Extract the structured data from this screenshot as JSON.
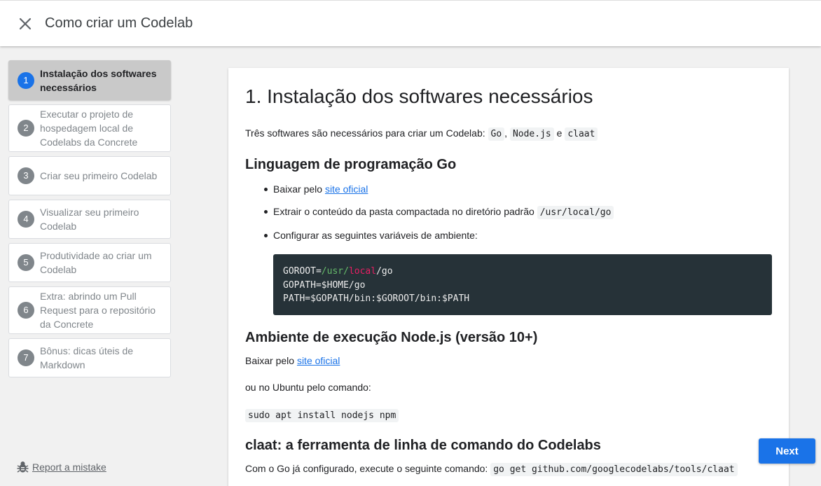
{
  "header": {
    "title": "Como criar um Codelab",
    "close_icon": "close-icon"
  },
  "sidebar": {
    "steps": [
      {
        "number": "1",
        "label": "Instalação dos softwares necessários",
        "active": true
      },
      {
        "number": "2",
        "label": "Executar o projeto de hospedagem local de Codelabs da Concrete"
      },
      {
        "number": "3",
        "label": "Criar seu primeiro Codelab"
      },
      {
        "number": "4",
        "label": "Visualizar seu primeiro Codelab"
      },
      {
        "number": "5",
        "label": "Produtividade ao criar um Codelab"
      },
      {
        "number": "6",
        "label": "Extra: abrindo um Pull Request para o repositório da Concrete"
      },
      {
        "number": "7",
        "label": "Bônus: dicas úteis de Markdown"
      }
    ],
    "report_label": "Report a mistake",
    "report_icon": "bug-icon"
  },
  "content": {
    "title": "1. Instalação dos softwares necessários",
    "intro_text": "Três softwares são necessários para criar um Codelab:",
    "intro_code1": "Go",
    "intro_sep": ",",
    "intro_code2": "Node.js",
    "intro_and": "e",
    "intro_code3": "claat",
    "go_heading": "Linguagem de programação Go",
    "go_item1_text": "Baixar pelo",
    "go_item1_link": "site oficial",
    "go_item2_text": "Extrair o conteúdo da pasta compactada no diretório padrão",
    "go_item2_code": "/usr/local/go",
    "go_item3_text": "Configurar as seguintes variáveis de ambiente:",
    "code_line1_a": "GOROOT=",
    "code_line1_b": "/usr/",
    "code_line1_c": "local",
    "code_line1_d": "/go",
    "code_line2": "GOPATH=$HOME/go",
    "code_line3": "PATH=$GOPATH/bin:$GOROOT/bin:$PATH",
    "node_heading": "Ambiente de execução Node.js (versão 10+)",
    "node_download_text": "Baixar pelo",
    "node_download_link": "site oficial",
    "node_ubuntu_text": "ou no Ubuntu pelo comando:",
    "node_command": "sudo apt install nodejs npm",
    "claat_heading": "claat: a ferramenta de linha de comando do Codelabs",
    "claat_text": "Com o Go já configurado, execute o seguinte comando:",
    "claat_command": "go get github.com/googlecodelabs/tools/claat"
  },
  "footer": {
    "next_label": "Next"
  },
  "colors": {
    "accent": "#1a73e8",
    "code_background": "#263238"
  }
}
